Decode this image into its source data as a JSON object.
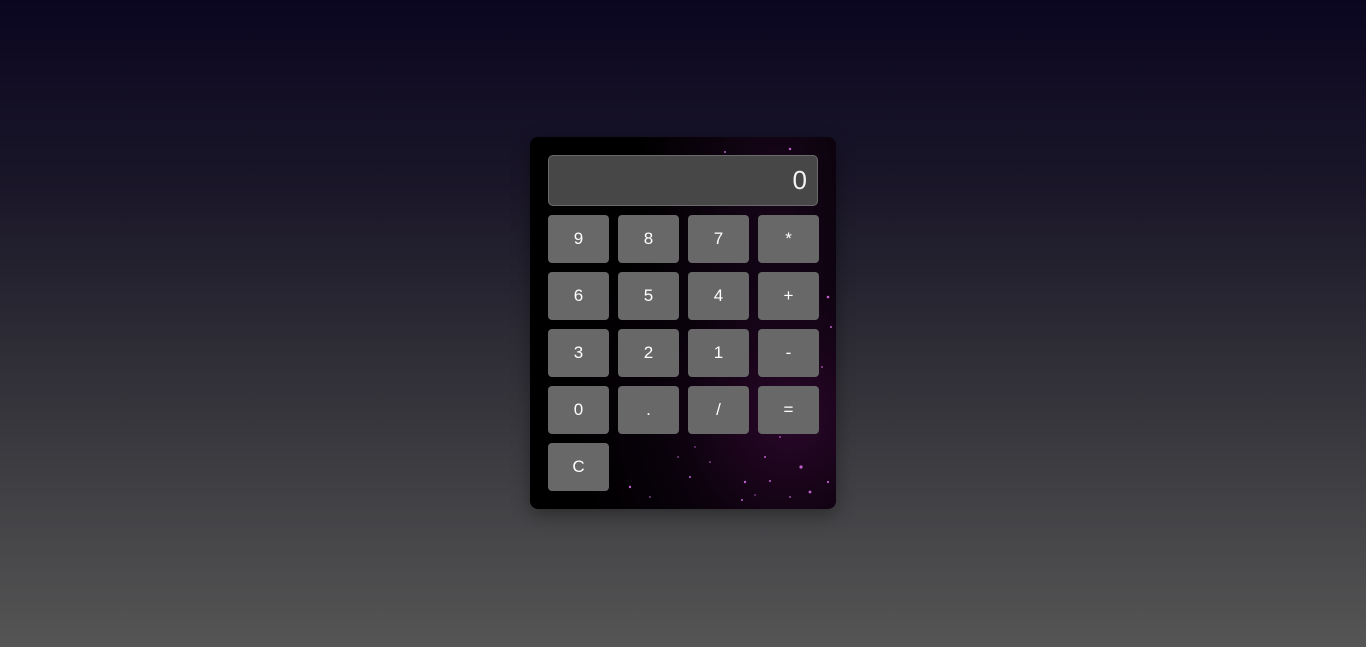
{
  "display": {
    "value": "0"
  },
  "keys": {
    "row1": [
      "9",
      "8",
      "7",
      "*"
    ],
    "row2": [
      "6",
      "5",
      "4",
      "+"
    ],
    "row3": [
      "3",
      "2",
      "1",
      "-"
    ],
    "row4": [
      "0",
      ".",
      "/",
      "="
    ],
    "row5": [
      "C"
    ]
  },
  "colors": {
    "key_bg": "#686868",
    "display_bg": "#474747",
    "panel_bg": "#000000",
    "accent_glow": "#8a2a9a"
  }
}
